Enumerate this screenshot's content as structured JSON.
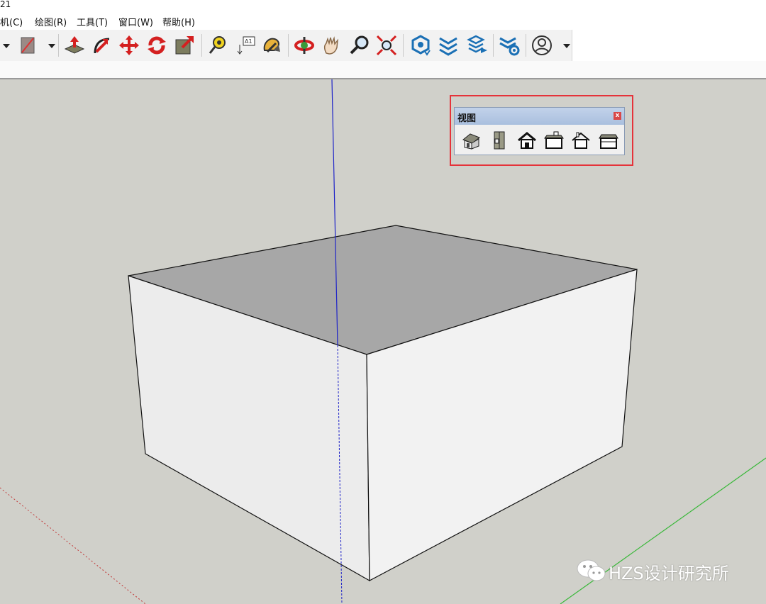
{
  "window": {
    "title_fragment": "21"
  },
  "menu": [
    {
      "id": "camera",
      "label": "机(C)"
    },
    {
      "id": "draw",
      "label": "绘图(R)"
    },
    {
      "id": "tools",
      "label": "工具(T)"
    },
    {
      "id": "window",
      "label": "窗口(W)"
    },
    {
      "id": "help",
      "label": "帮助(H)"
    }
  ],
  "toolbar": {
    "tools": [
      "dropdown-arrow",
      "paint-bucket",
      "dropdown-arrow",
      "push-pull",
      "follow-me",
      "move",
      "rotate",
      "scale",
      "tape-measure",
      "text-label",
      "paint-bucket-3d",
      "orbit",
      "pan",
      "zoom",
      "zoom-extents",
      "3d-warehouse",
      "extension-warehouse",
      "layer-send",
      "extension-manager",
      "account"
    ]
  },
  "views_toolbar": {
    "title": "视图",
    "close_label": "x",
    "buttons": [
      "iso-view",
      "top-view",
      "front-view",
      "right-view",
      "back-view",
      "left-view"
    ]
  },
  "watermark": {
    "text": "HZS设计研究所",
    "icon": "wechat-icon"
  },
  "colors": {
    "viewport_bg": "#d0d0ca",
    "top_face": "#a7a7a7",
    "side_face": "#ededed",
    "blue_axis": "#1f24c8",
    "green_axis": "#3ab83a",
    "red_axis": "#c23b3b",
    "highlight": "#e5333a"
  }
}
